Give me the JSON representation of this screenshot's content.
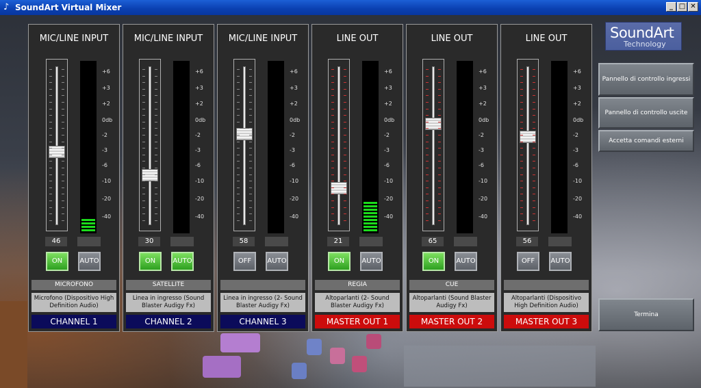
{
  "window": {
    "title": "SoundArt Virtual Mixer",
    "controls": [
      "_",
      "□",
      "✕"
    ]
  },
  "logo": {
    "main": "SoundArt",
    "sub": "Technology"
  },
  "scale_labels": [
    "+6",
    "+3",
    "+2",
    "0db",
    "-2",
    "-3",
    "-6",
    "-10",
    "-20",
    "-40"
  ],
  "strips": [
    {
      "title": "MIC/LINE INPUT",
      "value": "46",
      "fader_level": 0.46,
      "meter_bars": 4,
      "on_label": "ON",
      "on_state": true,
      "auto_label": "AUTO",
      "auto_state": false,
      "name": "MICROFONO",
      "description": "Microfono (Dispositivo High Definition Audio)",
      "channel": "CHANNEL 1",
      "channel_color": "#0b0b5a"
    },
    {
      "title": "MIC/LINE INPUT",
      "value": "30",
      "fader_level": 0.3,
      "meter_bars": 0,
      "on_label": "ON",
      "on_state": true,
      "auto_label": "AUTO",
      "auto_state": true,
      "name": "SATELLITE",
      "description": "Linea in ingresso (Sound Blaster Audigy Fx)",
      "channel": "CHANNEL 2",
      "channel_color": "#0b0b5a"
    },
    {
      "title": "MIC/LINE INPUT",
      "value": "58",
      "fader_level": 0.58,
      "meter_bars": 0,
      "on_label": "OFF",
      "on_state": false,
      "auto_label": "AUTO",
      "auto_state": false,
      "name": "",
      "description": "Linea in ingresso (2- Sound Blaster Audigy Fx)",
      "channel": "CHANNEL 3",
      "channel_color": "#0b0b5a"
    },
    {
      "title": "LINE OUT",
      "value": "21",
      "fader_level": 0.21,
      "meter_bars": 9,
      "on_label": "ON",
      "on_state": true,
      "auto_label": "AUTO",
      "auto_state": false,
      "name": "REGIA",
      "description": "Altoparlanti (2- Sound Blaster Audigy Fx)",
      "channel": "MASTER OUT 1",
      "channel_color": "#cc0c0c"
    },
    {
      "title": "LINE OUT",
      "value": "65",
      "fader_level": 0.65,
      "meter_bars": 0,
      "on_label": "ON",
      "on_state": true,
      "auto_label": "AUTO",
      "auto_state": false,
      "name": "CUE",
      "description": "Altoparlanti (Sound Blaster Audigy Fx)",
      "channel": "MASTER OUT 2",
      "channel_color": "#cc0c0c"
    },
    {
      "title": "LINE OUT",
      "value": "56",
      "fader_level": 0.56,
      "meter_bars": 0,
      "on_label": "OFF",
      "on_state": false,
      "auto_label": "AUTO",
      "auto_state": false,
      "name": "",
      "description": "Altoparlanti (Dispositivo High Definition Audio)",
      "channel": "MASTER OUT 3",
      "channel_color": "#cc0c0c"
    }
  ],
  "side_buttons": {
    "inputs_panel": "Pannello di controllo ingressi",
    "outputs_panel": "Pannello di controllo uscite",
    "external_commands": "Accetta comandi esterni",
    "quit": "Termina"
  }
}
